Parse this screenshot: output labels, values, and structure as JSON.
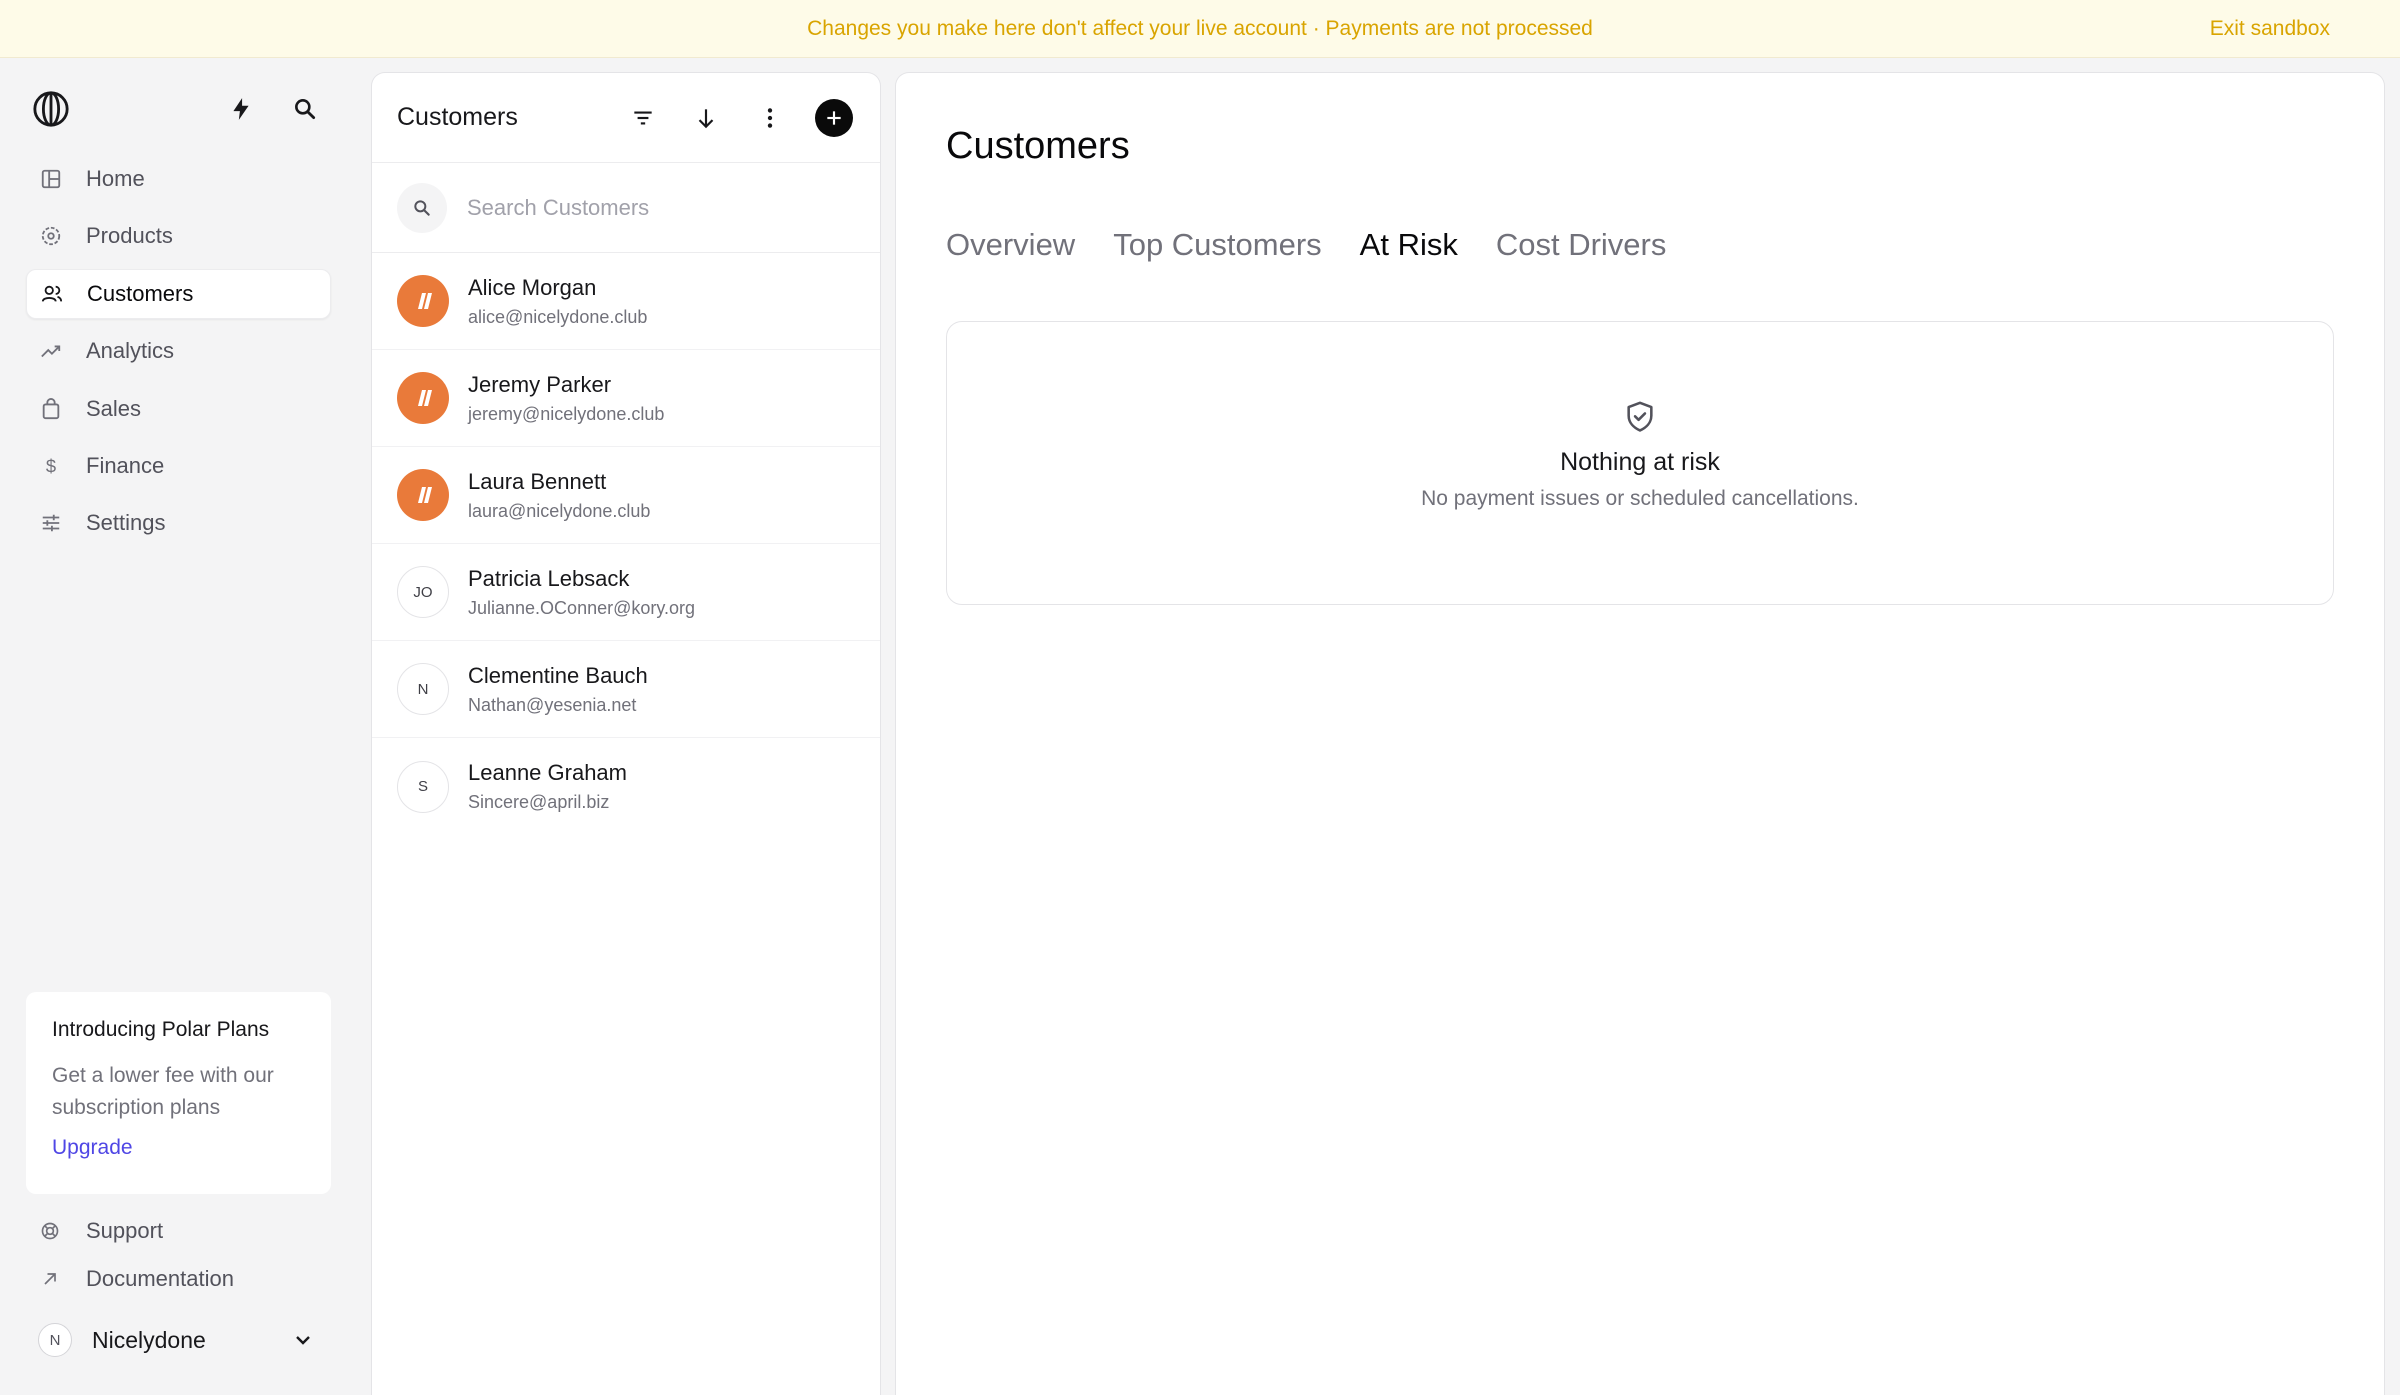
{
  "banner": {
    "message": "Changes you make here don't affect your live account · Payments are not processed",
    "exit_label": "Exit sandbox"
  },
  "sidebar": {
    "items": [
      {
        "label": "Home",
        "icon": "home-icon"
      },
      {
        "label": "Products",
        "icon": "products-icon"
      },
      {
        "label": "Customers",
        "icon": "customers-icon",
        "active": true
      },
      {
        "label": "Analytics",
        "icon": "analytics-icon"
      },
      {
        "label": "Sales",
        "icon": "sales-icon"
      },
      {
        "label": "Finance",
        "icon": "finance-icon"
      },
      {
        "label": "Settings",
        "icon": "settings-icon"
      }
    ],
    "promo": {
      "title": "Introducing Polar Plans",
      "body": "Get a lower fee with our subscription plans",
      "link": "Upgrade"
    },
    "links": [
      {
        "label": "Support",
        "icon": "support-icon"
      },
      {
        "label": "Documentation",
        "icon": "external-link-icon"
      }
    ],
    "org": {
      "initial": "N",
      "name": "Nicelydone"
    }
  },
  "customers_list": {
    "title": "Customers",
    "search_placeholder": "Search Customers",
    "rows": [
      {
        "name": "Alice Morgan",
        "email": "alice@nicelydone.club",
        "avatar": "brand"
      },
      {
        "name": "Jeremy Parker",
        "email": "jeremy@nicelydone.club",
        "avatar": "brand"
      },
      {
        "name": "Laura Bennett",
        "email": "laura@nicelydone.club",
        "avatar": "brand"
      },
      {
        "name": "Patricia Lebsack",
        "email": "Julianne.OConner@kory.org",
        "avatar": "JO"
      },
      {
        "name": "Clementine Bauch",
        "email": "Nathan@yesenia.net",
        "avatar": "N"
      },
      {
        "name": "Leanne Graham",
        "email": "Sincere@april.biz",
        "avatar": "S"
      }
    ]
  },
  "main": {
    "title": "Customers",
    "tabs": [
      "Overview",
      "Top Customers",
      "At Risk",
      "Cost Drivers"
    ],
    "active_tab": "At Risk",
    "empty_state": {
      "icon": "shield-check-icon",
      "title": "Nothing at risk",
      "subtitle": "No payment issues or scheduled cancellations."
    }
  },
  "colors": {
    "banner_bg": "#fefbe8",
    "banner_text": "#d9a400",
    "brand_avatar": "#e97a3a",
    "link": "#4f46e5"
  }
}
